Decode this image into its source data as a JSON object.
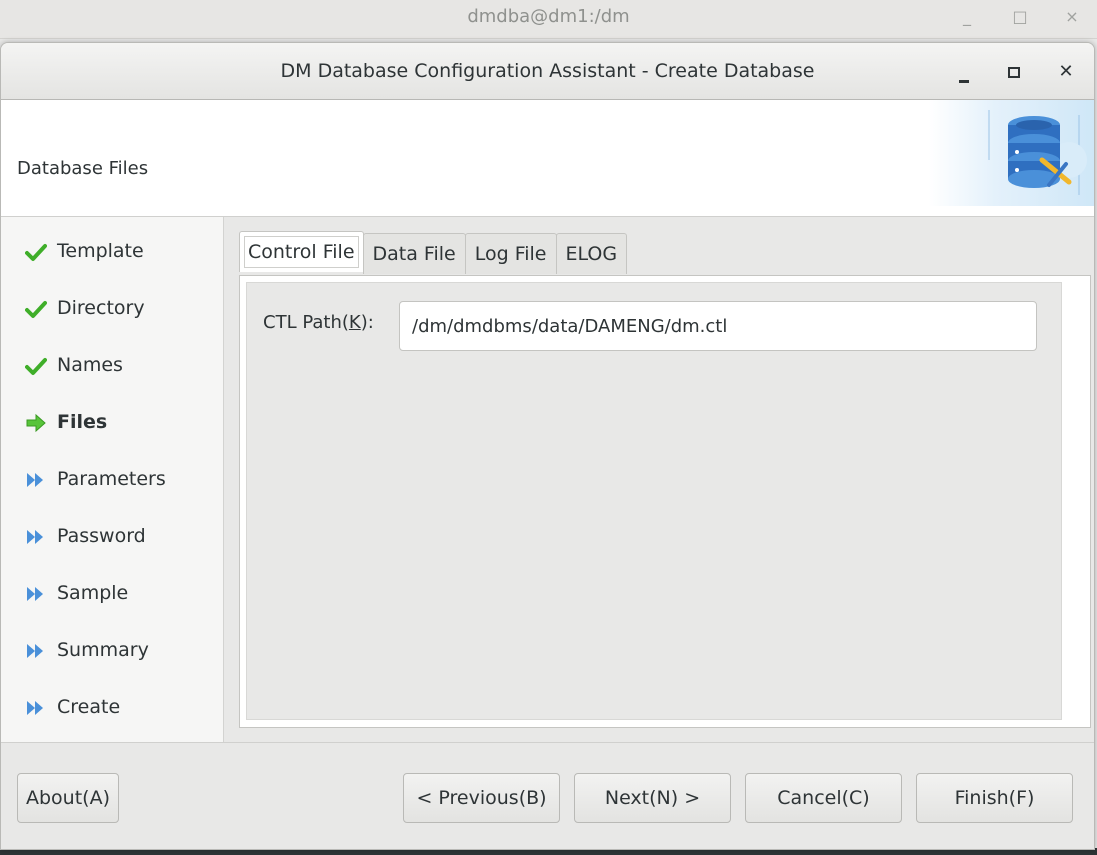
{
  "background_window": {
    "title": "dmdba@dm1:/dm",
    "controls": [
      "_",
      "□",
      "×"
    ]
  },
  "dialog": {
    "title": "DM Database Configuration Assistant - Create Database",
    "header_title": "Database Files"
  },
  "sidebar": {
    "steps": [
      {
        "label": "Template",
        "state": "done"
      },
      {
        "label": "Directory",
        "state": "done"
      },
      {
        "label": "Names",
        "state": "done"
      },
      {
        "label": "Files",
        "state": "current"
      },
      {
        "label": "Parameters",
        "state": "pending"
      },
      {
        "label": "Password",
        "state": "pending"
      },
      {
        "label": "Sample",
        "state": "pending"
      },
      {
        "label": "Summary",
        "state": "pending"
      },
      {
        "label": "Create",
        "state": "pending"
      }
    ]
  },
  "tabs": [
    {
      "label": "Control File",
      "active": true
    },
    {
      "label": "Data File",
      "active": false
    },
    {
      "label": "Log File",
      "active": false
    },
    {
      "label": "ELOG",
      "active": false
    }
  ],
  "control_file": {
    "label_text": "CTL Path(",
    "label_mnemonic": "K",
    "label_suffix": "):",
    "value": "/dm/dmdbms/data/DAMENG/dm.ctl"
  },
  "buttons": {
    "about": "About(A)",
    "previous": "< Previous(B)",
    "next": "Next(N) >",
    "cancel": "Cancel(C)",
    "finish": "Finish(F)"
  },
  "colors": {
    "check_green": "#3fae29",
    "arrow_green": "#58c43a",
    "pending_blue": "#4a90d9"
  }
}
